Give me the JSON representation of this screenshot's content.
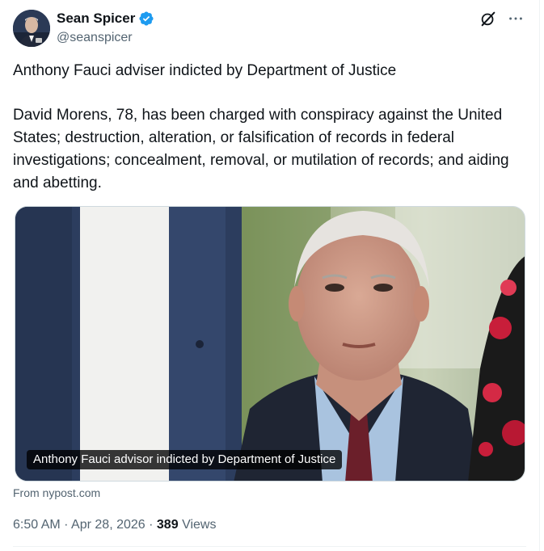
{
  "author": {
    "display_name": "Sean Spicer",
    "handle": "@seanspicer",
    "verified": true,
    "avatar_icon": "avatar-photo"
  },
  "actions": {
    "grok_icon": "grok-icon",
    "more_icon": "more-icon"
  },
  "tweet": {
    "headline": "Anthony Fauci adviser indicted by Department of Justice",
    "body": "David Morens, 78, has been charged with conspiracy against the United States; destruction, alteration, or falsification of records in federal investigations; concealment, removal, or mutilation of records; and aiding and abetting."
  },
  "media": {
    "caption": "Anthony Fauci advisor indicted by Department of Justice",
    "source": "From nypost.com"
  },
  "meta": {
    "time": "6:50 AM",
    "date": "Apr 28, 2026",
    "separator": "·",
    "views_count": "389",
    "views_label": "Views"
  },
  "colors": {
    "verified": "#1d9bf0",
    "text": "#0f1419",
    "secondary": "#536471"
  }
}
